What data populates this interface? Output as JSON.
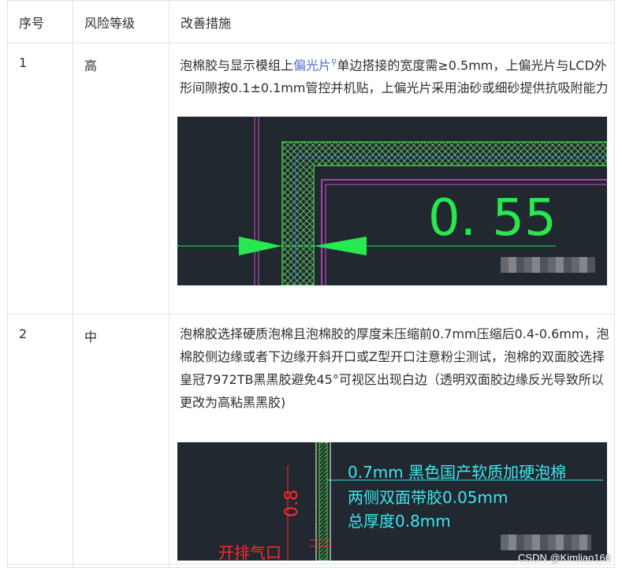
{
  "headers": {
    "no": "序号",
    "risk": "风险等级",
    "measure": "改善措施"
  },
  "rows": [
    {
      "no": "1",
      "risk": "高",
      "desc_pre": "泡棉胶与显示模组上",
      "link": "偏光片",
      "link_icon": "search-icon",
      "desc_post": "单边搭接的宽度需≥0.5mm，上偏光片与LCD外形间隙按0.1±0.1mm管控并机贴，上偏光片采用油砂或细砂提供抗吸附能力",
      "figure": {
        "dimension_value": "0. 55"
      }
    },
    {
      "no": "2",
      "risk": "中",
      "desc": "泡棉胶选择硬质泡棉且泡棉胶的厚度未压缩前0.7mm压缩后0.4-0.6mm，泡棉胶侧边缘或者下边缘开斜开口或Z型开口注意粉尘测试，泡棉的双面胶选择皇冠7972TB黑黑胶避免45°可视区出现白边（透明双面胶边缘反光导致所以更改为高粘黑黑胶)",
      "figure": {
        "vertical_dim": "0.8",
        "note_lines": [
          "0.7mm 黑色国产软质加硬泡棉",
          "两侧双面带胶0.05mm",
          "总厚度0.8mm"
        ],
        "red_label": "开排气口"
      }
    }
  ],
  "watermark": "CSDN @Kimliao166",
  "colors": {
    "border": "#dfe2e5",
    "link": "#4d6ed1",
    "cad_bg": "#212830",
    "cad_green": "#27e84f",
    "cad_cyan": "#3ee6f0",
    "cad_red": "#ff2a2a"
  }
}
